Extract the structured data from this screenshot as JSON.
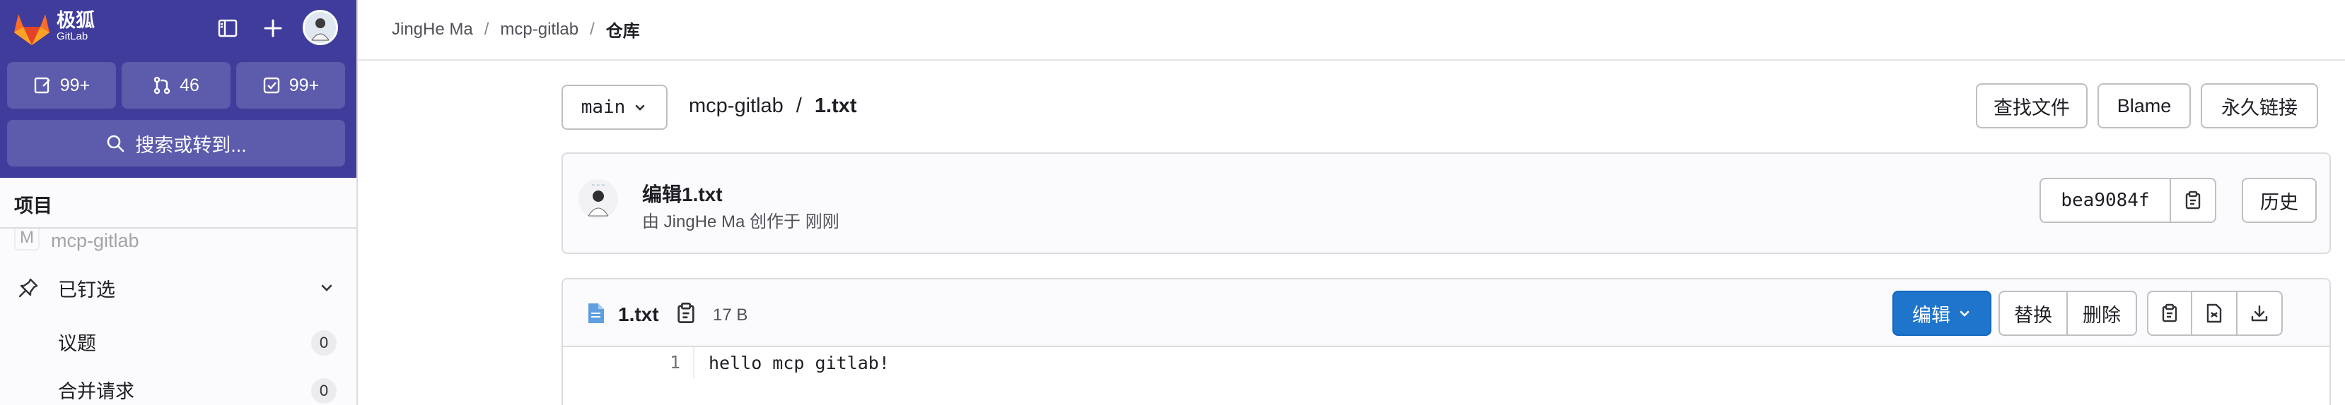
{
  "brand": {
    "name": "极狐",
    "sub": "GitLab"
  },
  "sidebar": {
    "counters": {
      "issues": "99+",
      "merge_requests": "46",
      "todos": "99+"
    },
    "search_label": "搜索或转到...",
    "section_title": "项目",
    "project_faded": {
      "initial": "M",
      "name": "mcp-gitlab"
    },
    "pinned_label": "已钉选",
    "items": [
      {
        "label": "议题",
        "count": "0"
      },
      {
        "label": "合并请求",
        "count": "0"
      }
    ]
  },
  "breadcrumb": {
    "user": "JingHe Ma",
    "project": "mcp-gitlab",
    "current": "仓库"
  },
  "repo": {
    "branch": "main",
    "path_project": "mcp-gitlab",
    "path_sep": "/",
    "path_file": "1.txt",
    "buttons": {
      "find_file": "查找文件",
      "blame": "Blame",
      "permalink": "永久链接"
    }
  },
  "commit": {
    "title": "编辑1.txt",
    "byline": "由 JingHe Ma 创作于 刚刚",
    "sha": "bea9084f",
    "history_label": "历史"
  },
  "file": {
    "name": "1.txt",
    "size": "17 B",
    "edit_label": "编辑",
    "replace_label": "替换",
    "delete_label": "删除",
    "lines": [
      {
        "number": "1",
        "text": "hello mcp gitlab!"
      }
    ]
  },
  "colors": {
    "sidebar_header": "#3f3c9c",
    "primary_button": "#1f75cb",
    "logo_orange": "#e24329"
  }
}
